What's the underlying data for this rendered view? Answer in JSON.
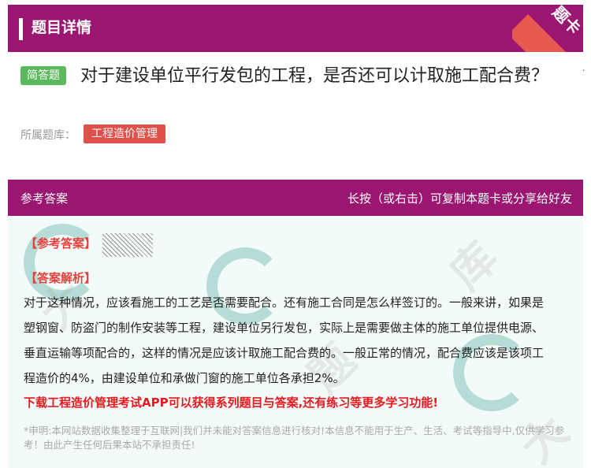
{
  "header": {
    "title": "题目详情",
    "ribbon": "题卡"
  },
  "question": {
    "type_badge": "简答题",
    "text": "对于建设单位平行发包的工程，是否还可以计取施工配合费？",
    "library_label": "所属题库：",
    "library_tag": "工程造价管理"
  },
  "answer": {
    "section_title": "参考答案",
    "share_hint": "长按（或右击）可复制本题卡或分享给好友",
    "reference_label": "【参考答案】",
    "explanation_label": "【答案解析】",
    "explanation": "对于这种情况，应该看施工的工艺是否需要配合。还有施工合同是怎么样签订的。一般来讲，如果是塑钢窗、防盗门的制作安装等工程，建设单位另行发包，实际上是需要做主体的施工单位提供电源、垂直运输等项配合的，这样的情况是应该计取施工配合费的。一般正常的情况，配合费应该是该项工程造价的4%，由建设单位和承做门窗的施工单位各承担2%。",
    "promo": "下载工程造价管理考试APP可以获得系列题目与答案,还有练习等更多学习功能!",
    "disclaimer": "*申明:本网站数据收集整理于互联网|我们并未能对答案信息进行核对!本信息不能用于生产、生活、考试等指导中,仅供学习参考！由此产生任何后果本站不承担责任!"
  },
  "colors": {
    "brand": "#9b1670",
    "accent_red": "#e8403b",
    "badge_green": "#5cb85c"
  }
}
